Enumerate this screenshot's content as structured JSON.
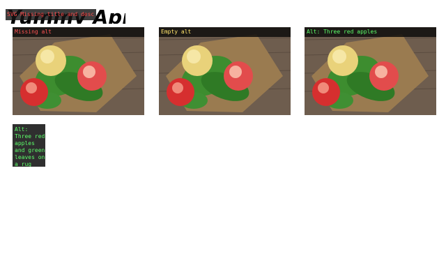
{
  "svg_heading": {
    "text": "Yummy Apples!",
    "badge": "SVG Missing title and desc"
  },
  "cards": [
    {
      "badge": "Missing alt",
      "status": "missing"
    },
    {
      "badge": "Empty alt",
      "status": "empty"
    },
    {
      "badge": "Alt: Three red apples",
      "status": "ok"
    }
  ],
  "text_image": {
    "label": "Alt:",
    "text": "Three red apples and green leaves on a rug"
  },
  "colors": {
    "missing": "#ff5353",
    "empty": "#ffe36b",
    "ok": "#5dff6a"
  }
}
